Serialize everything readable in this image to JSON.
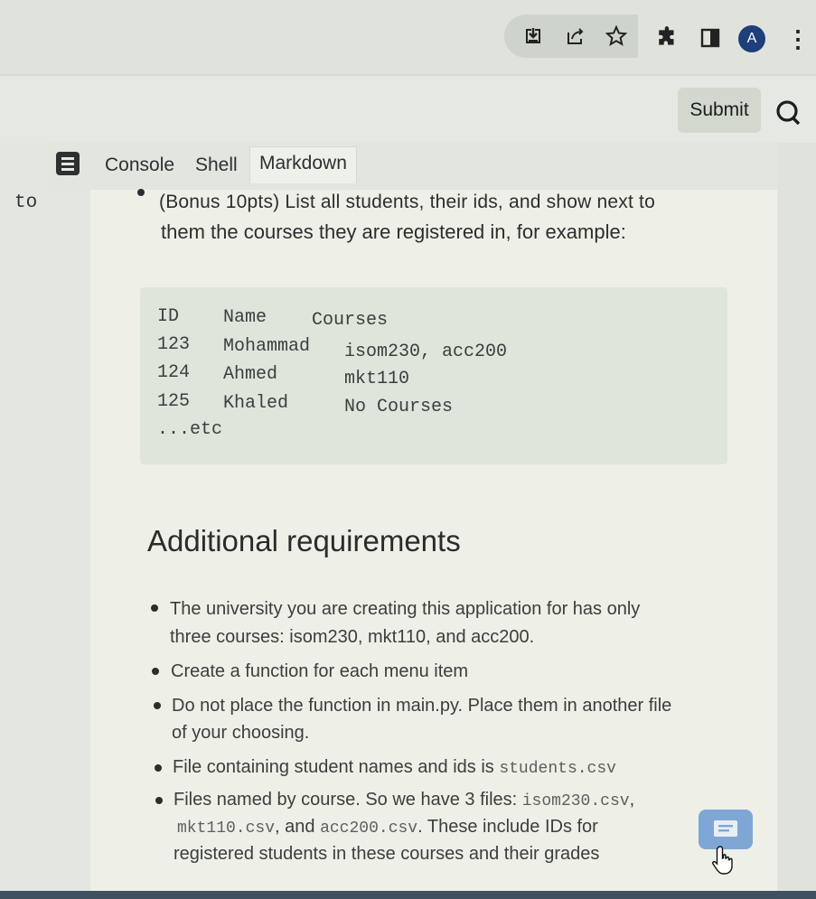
{
  "browser": {
    "icons": [
      "download-icon",
      "share-icon",
      "star-icon",
      "extensions-icon",
      "sidepanel-icon"
    ],
    "avatar_letter": "A",
    "menu_glyph": "⋮"
  },
  "toolbar": {
    "submit_label": "Submit",
    "search_icon": "search-icon"
  },
  "left_pane": {
    "text": "to"
  },
  "tabs": {
    "items": [
      {
        "label": "Console"
      },
      {
        "label": "Shell"
      },
      {
        "label": "Markdown"
      }
    ],
    "active": "Markdown"
  },
  "doc": {
    "intro_line1": "(Bonus 10pts) List all students, their ids, and show next to",
    "intro_line2": "them the courses they are registered in, for example:",
    "code": {
      "header": [
        "ID",
        "Name",
        "Courses"
      ],
      "rows": [
        [
          "123",
          "Mohammad",
          "isom230, acc200"
        ],
        [
          "124",
          "Ahmed",
          "mkt110"
        ],
        [
          "125",
          "Khaled",
          "No Courses"
        ]
      ],
      "tail": "...etc"
    },
    "heading": "Additional requirements",
    "requirements": {
      "r1_line1": "The university you are creating this application for has only",
      "r1_line2": "three courses: isom230, mkt110, and acc200.",
      "r2": "Create a function for each menu item",
      "r3_line1": "Do not place the function in main.py. Place them in another file",
      "r3_line2": "of your choosing.",
      "r4_text": "File containing student names and ids is",
      "r4_code": "students.csv",
      "r5_text": "Files named by course. So we have 3 files:",
      "r5_code1": "isom230.csv",
      "r5_sep1": ",",
      "r5_code2": "mkt110.csv",
      "r5_sep2": ", and",
      "r5_code3": "acc200.csv",
      "r5_tail": ". These include IDs for",
      "r5_line3": "registered students in these courses and their grades"
    }
  },
  "colors": {
    "accent": "#1e3f7a",
    "chat_button": "#7fa7d6",
    "background": "#eef0e8"
  }
}
